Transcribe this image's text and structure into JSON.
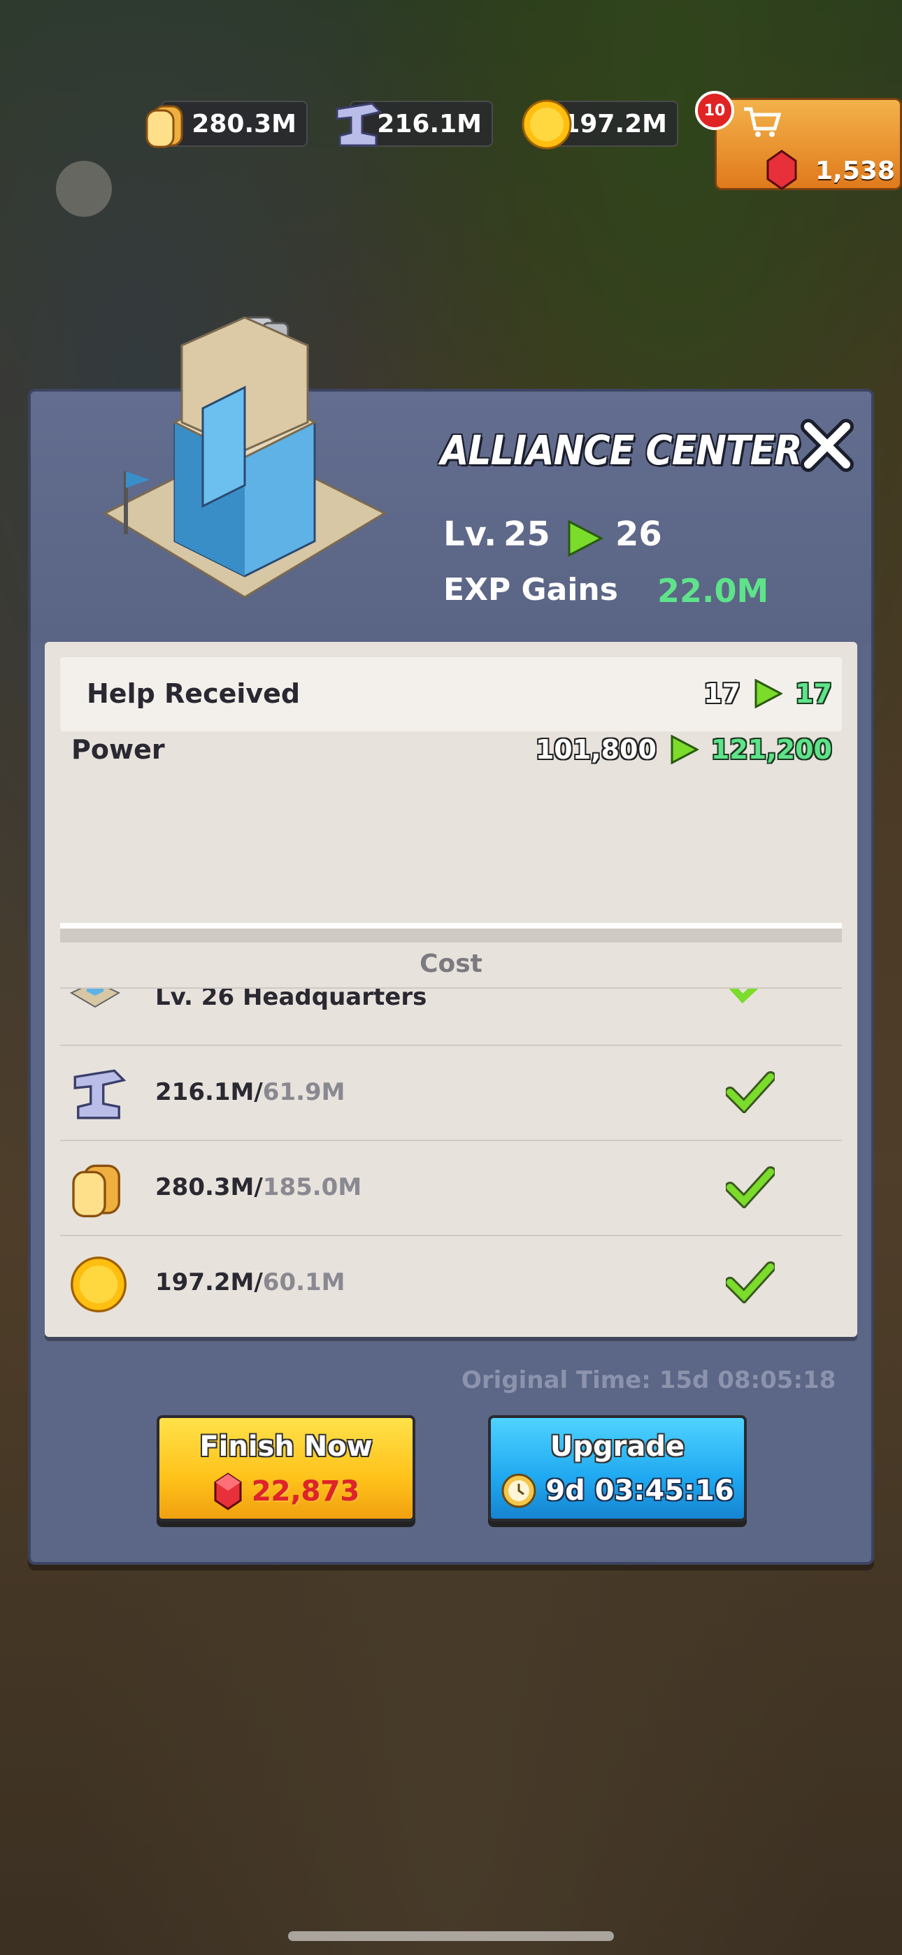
{
  "resources": {
    "bread": {
      "value": "280.3M",
      "icon": "bread-icon"
    },
    "iron": {
      "value": "216.1M",
      "icon": "iron-icon"
    },
    "coin": {
      "value": "197.2M",
      "icon": "coin-icon"
    }
  },
  "shop": {
    "badge": "10",
    "gems": "1,538"
  },
  "building": {
    "title": "ALLIANCE CENTER",
    "level_label": "Lv.",
    "level_from": "25",
    "level_to": "26",
    "exp_label": "EXP Gains",
    "exp_value": "22.0M"
  },
  "stats": [
    {
      "label": "Help Received",
      "from": "17",
      "to": "17"
    },
    {
      "label": "Power",
      "from": "101,800",
      "to": "121,200"
    }
  ],
  "cost": {
    "title": "Cost",
    "requirement": "Lv. 26 Headquarters",
    "items": [
      {
        "have": "216.1M/",
        "need": "61.9M",
        "icon": "iron-icon"
      },
      {
        "have": "280.3M/",
        "need": "185.0M",
        "icon": "bread-icon"
      },
      {
        "have": "197.2M/",
        "need": "60.1M",
        "icon": "coin-icon"
      }
    ]
  },
  "original_time": "Original Time: 15d 08:05:18",
  "buttons": {
    "finish_label": "Finish Now",
    "finish_cost": "22,873",
    "upgrade_label": "Upgrade",
    "upgrade_time": "9d 03:45:16"
  },
  "colors": {
    "panel": "#5c6686",
    "green": "#5ee38a",
    "finish": "#ffc21a",
    "upgrade": "#1fa8f0"
  }
}
